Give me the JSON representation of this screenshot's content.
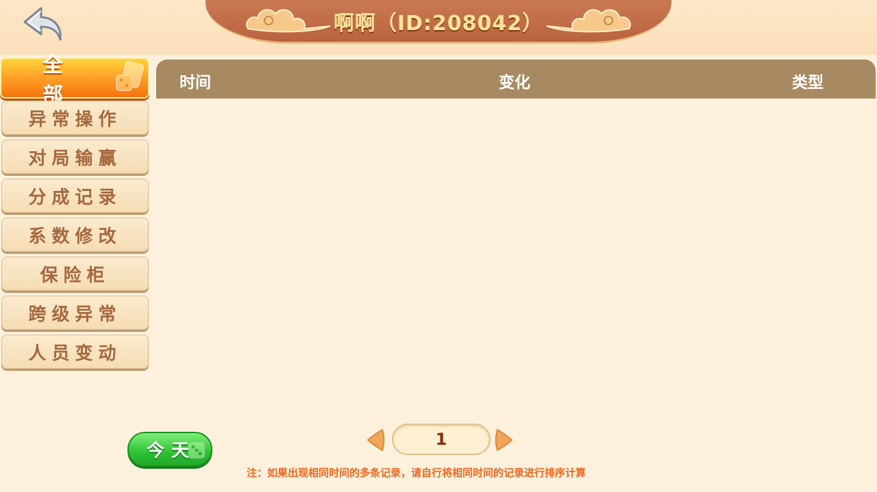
{
  "header": {
    "title": "啊啊（ID:208042）"
  },
  "sidebar": {
    "items": [
      {
        "label": "全 部",
        "active": true
      },
      {
        "label": "异常操作",
        "active": false
      },
      {
        "label": "对局输赢",
        "active": false
      },
      {
        "label": "分成记录",
        "active": false
      },
      {
        "label": "系数修改",
        "active": false
      },
      {
        "label": "保险柜",
        "active": false
      },
      {
        "label": "跨级异常",
        "active": false
      },
      {
        "label": "人员变动",
        "active": false
      }
    ]
  },
  "table": {
    "columns": {
      "time": "时间",
      "change": "变化",
      "type": "类型"
    },
    "rows": []
  },
  "filter": {
    "today_label": "今天"
  },
  "pager": {
    "current_page": "1"
  },
  "notice": "注：如果出现相同时间的多条记录，请自行将相同时间的记录进行排序计算",
  "colors": {
    "background": "#fdf1dd",
    "banner": "#c06c47",
    "title_text": "#ffe49a",
    "active_tab": "#ff9a22",
    "table_header": "#a78a62",
    "today_button": "#2dc233",
    "notice_text": "#f0661d"
  },
  "icons": {
    "back": "back-arrow-icon",
    "prev": "chevron-left-icon",
    "next": "chevron-right-icon",
    "cards": "playing-cards-icon",
    "dice": "dice-icon",
    "cloud": "cloud-ornament-icon"
  }
}
